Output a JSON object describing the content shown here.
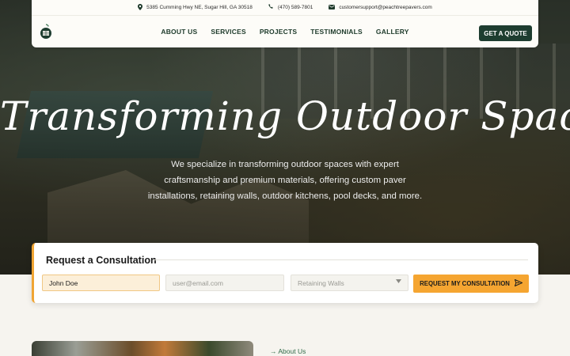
{
  "topbar": {
    "address": "5385 Cumming Hwy NE, Sugar Hill, GA 30518",
    "phone": "(470) 589-7801",
    "email": "customersupport@peachtreepavers.com"
  },
  "nav": {
    "items": [
      "ABOUT US",
      "SERVICES",
      "PROJECTS",
      "TESTIMONIALS",
      "GALLERY"
    ],
    "cta": "GET A QUOTE"
  },
  "hero": {
    "title": "Transforming Outdoor Spaces",
    "subtitle": "We specialize in transforming outdoor spaces with expert craftsmanship and premium materials, offering custom paver installations, retaining walls, outdoor kitchens, pool decks, and more."
  },
  "consultation": {
    "heading": "Request a Consultation",
    "name_value": "John Doe",
    "email_placeholder": "user@email.com",
    "service_selected": "Retaining Walls",
    "submit_label": "REQUEST MY CONSULTATION"
  },
  "about": {
    "link_label": "→ About Us"
  },
  "colors": {
    "brand_green": "#1e3d30",
    "accent_orange": "#f5a531",
    "link_green": "#2f6a47"
  },
  "icons": [
    "location-pin-icon",
    "phone-icon",
    "email-icon",
    "logo-icon",
    "chevron-down-icon",
    "send-arrow-icon"
  ]
}
